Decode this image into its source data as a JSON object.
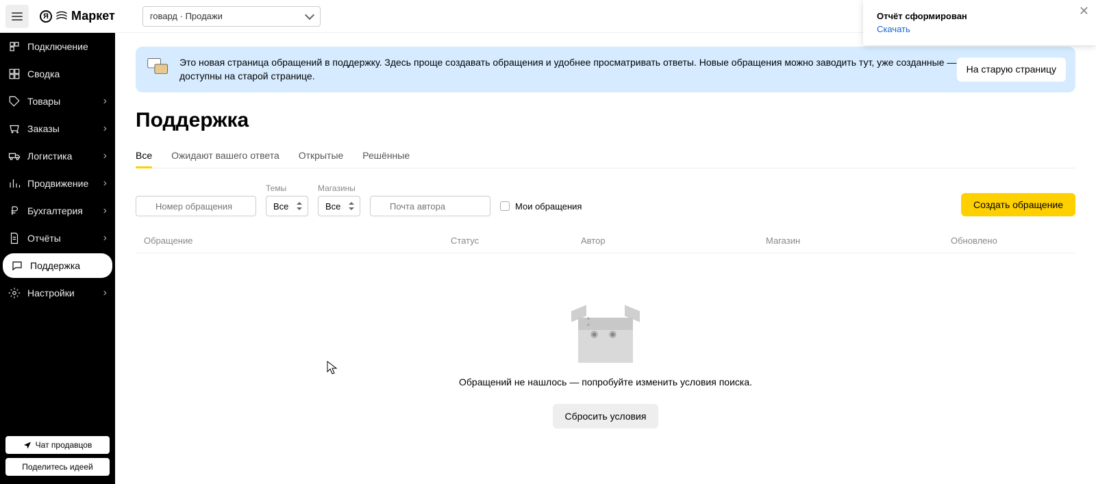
{
  "brand": {
    "name": "Маркет"
  },
  "account_selector": {
    "label": "говард · Продажи"
  },
  "toast": {
    "title": "Отчёт сформирован",
    "link": "Скачать"
  },
  "sidebar": {
    "items": [
      {
        "key": "connect",
        "label": "Подключение",
        "sub": false
      },
      {
        "key": "summary",
        "label": "Сводка",
        "sub": false
      },
      {
        "key": "products",
        "label": "Товары",
        "sub": true
      },
      {
        "key": "orders",
        "label": "Заказы",
        "sub": true
      },
      {
        "key": "logistics",
        "label": "Логистика",
        "sub": true
      },
      {
        "key": "promo",
        "label": "Продвижение",
        "sub": true
      },
      {
        "key": "accounting",
        "label": "Бухгалтерия",
        "sub": true
      },
      {
        "key": "reports",
        "label": "Отчёты",
        "sub": true
      },
      {
        "key": "support",
        "label": "Поддержка",
        "sub": false,
        "active": true
      },
      {
        "key": "settings",
        "label": "Настройки",
        "sub": true
      }
    ],
    "bottom": {
      "chat": "Чат продавцов",
      "idea": "Поделитесь идеей"
    }
  },
  "banner": {
    "text": "Это новая страница обращений в поддержку. Здесь проще создавать обращения и удобнее просматривать ответы. Новые обращения можно заводить тут, уже созданные — доступны на старой странице.",
    "button": "На старую страницу"
  },
  "page_title": "Поддержка",
  "tabs": [
    {
      "label": "Все",
      "active": true
    },
    {
      "label": "Ожидают вашего ответа"
    },
    {
      "label": "Открытые"
    },
    {
      "label": "Решённые"
    }
  ],
  "filters": {
    "search_placeholder": "Номер обращения",
    "topics_label": "Темы",
    "topics_value": "Все",
    "shops_label": "Магазины",
    "shops_value": "Все",
    "author_placeholder": "Почта автора",
    "mine_label": "Мои обращения"
  },
  "create_button": "Создать обращение",
  "table_headers": {
    "c1": "Обращение",
    "c2": "Статус",
    "c3": "Автор",
    "c4": "Магазин",
    "c5": "Обновлено"
  },
  "empty_state": {
    "text": "Обращений не нашлось — попробуйте изменить условия поиска.",
    "reset": "Сбросить условия"
  }
}
